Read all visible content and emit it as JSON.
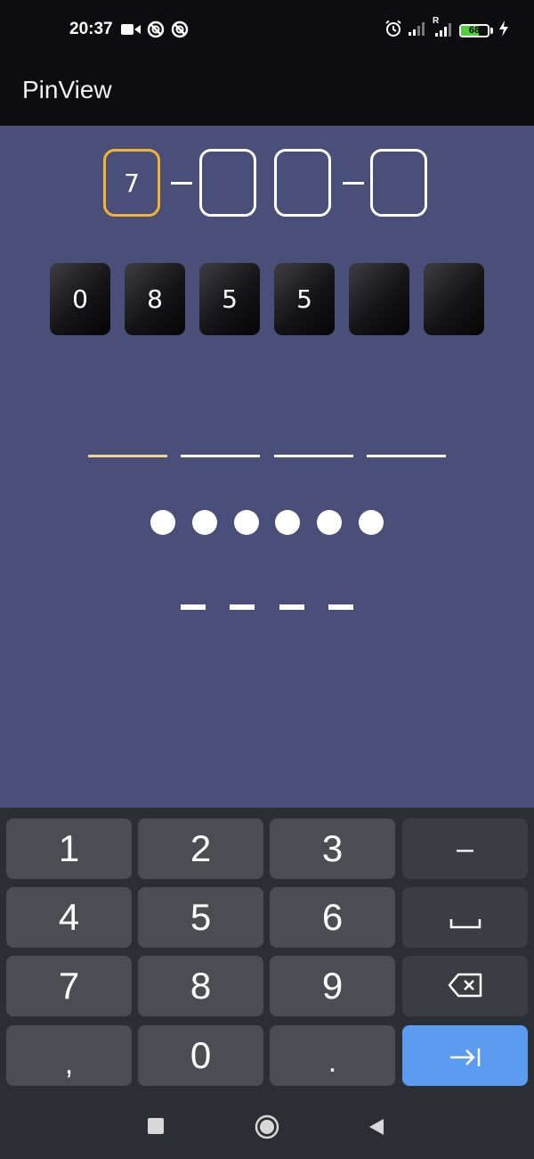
{
  "status_bar": {
    "time": "20:37",
    "battery_level": "68",
    "battery_fraction": 0.68,
    "left_icons": [
      "video-camera-icon",
      "blocked-notification-icon",
      "blocked-notification-icon"
    ],
    "right_icons": [
      "alarm-icon",
      "signal-icon",
      "roaming-signal-icon",
      "battery-icon",
      "charging-icon"
    ],
    "roaming_label": "R"
  },
  "app_bar": {
    "title": "PinView"
  },
  "pin_outline": {
    "digits": [
      "7",
      "",
      "",
      ""
    ],
    "active_index": 0,
    "separators": [
      "–",
      "–"
    ],
    "accent_color": "#f5b42b"
  },
  "pin_dark": {
    "digits": [
      "0",
      "8",
      "5",
      "5",
      "",
      ""
    ]
  },
  "pin_underline": {
    "count": 4,
    "active_index": 0,
    "active_color": "#f3d68e"
  },
  "pin_dots": {
    "count": 6
  },
  "pin_dashes": {
    "count": 4
  },
  "keyboard": {
    "rows": [
      [
        "1",
        "2",
        "3",
        "-"
      ],
      [
        "4",
        "5",
        "6",
        "space"
      ],
      [
        "7",
        "8",
        "9",
        "backspace"
      ],
      [
        ",",
        "0",
        ".",
        "enter"
      ]
    ],
    "labels": {
      "k1": "1",
      "k2": "2",
      "k3": "3",
      "kminus": "–",
      "k4": "4",
      "k5": "5",
      "k6": "6",
      "k7": "7",
      "k8": "8",
      "k9": "9",
      "kcomma": ",",
      "k0": "0",
      "kdot": "."
    },
    "enter_color": "#5b9cf0"
  },
  "nav_bar": {
    "icons": [
      "recent-apps-icon",
      "home-icon",
      "back-icon"
    ]
  }
}
